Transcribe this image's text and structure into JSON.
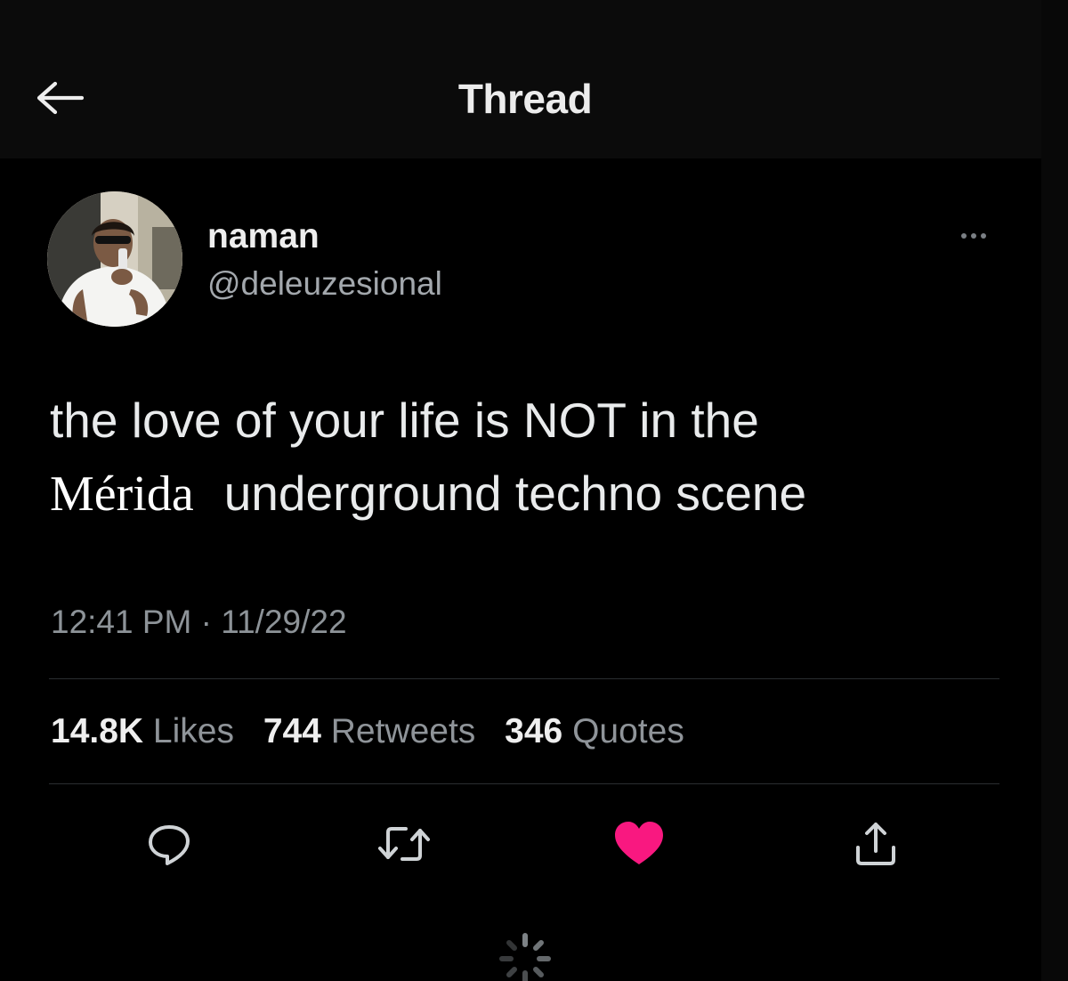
{
  "header": {
    "title": "Thread",
    "back_icon": "arrow-left-icon"
  },
  "tweet": {
    "author": {
      "name": "naman",
      "handle": "@deleuzesional",
      "avatar_icon": "user-photo"
    },
    "text_line1": "the love of your life is NOT in the",
    "text_line2_word": "Mérida",
    "text_line2_rest": "underground techno scene",
    "timestamp": "12:41 PM · 11/29/22",
    "stats": {
      "likes_count": "14.8K",
      "likes_label": "Likes",
      "retweets_count": "744",
      "retweets_label": "Retweets",
      "quotes_count": "346",
      "quotes_label": "Quotes"
    }
  },
  "actions": {
    "reply_icon": "reply-icon",
    "retweet_icon": "retweet-icon",
    "like_icon": "heart-icon",
    "share_icon": "share-icon"
  },
  "colors": {
    "background": "#000000",
    "header_bg": "#0b0b0b",
    "text_primary": "#e7e9ea",
    "text_secondary": "#8d9398",
    "like_active": "#f91880",
    "divider": "#2a2d30"
  }
}
